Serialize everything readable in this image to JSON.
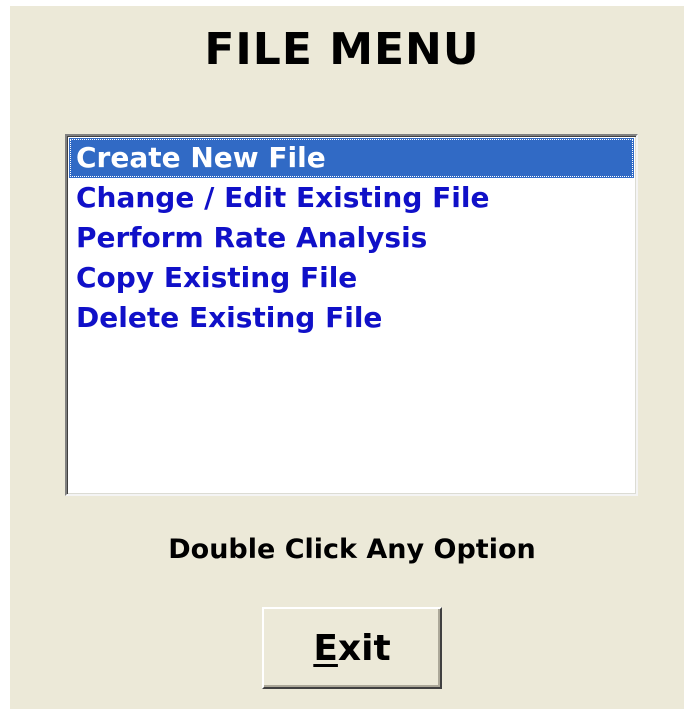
{
  "title": "FILE MENU",
  "options": {
    "items": [
      {
        "label": "Create New File",
        "selected": true
      },
      {
        "label": "Change / Edit Existing File",
        "selected": false
      },
      {
        "label": "Perform Rate Analysis",
        "selected": false
      },
      {
        "label": "Copy Existing File",
        "selected": false
      },
      {
        "label": "Delete Existing File",
        "selected": false
      }
    ]
  },
  "hint": "Double Click Any Option",
  "exit_button": {
    "label": "Exit",
    "mnemonic": "E",
    "rest": "xit"
  },
  "colors": {
    "dialog_background": "#ECE9D8",
    "selection_background": "#316AC5",
    "item_text": "#1010C8"
  }
}
